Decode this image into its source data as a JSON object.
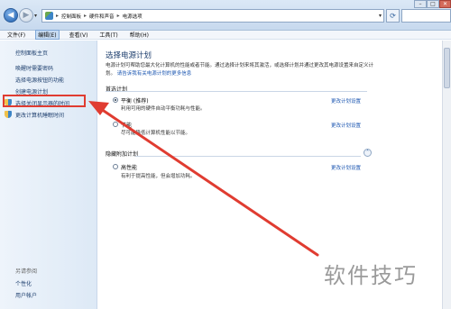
{
  "breadcrumb": {
    "items": [
      "控制面板",
      "硬件和声音",
      "电源选项"
    ]
  },
  "menu": {
    "items": [
      "文件(F)",
      "编辑(E)",
      "查看(V)",
      "工具(T)",
      "帮助(H)"
    ]
  },
  "sidebar": {
    "home": "控制面板主页",
    "items": [
      "唤醒时需要密码",
      "选择电源按钮的功能",
      "创建电源计划",
      "选择关闭显示器的时间",
      "更改计算机睡眠时间"
    ],
    "see_also_title": "另请参阅",
    "see_also": [
      "个性化",
      "用户帐户"
    ]
  },
  "main": {
    "title": "选择电源计划",
    "description": "电源计划可帮助您最大化计算机的性能或者节能。通过选择计划来将其激活，或选择计划并通过更改其电源设置来自定义计划。",
    "more_link": "请告诉我有关电源计划的更多信息",
    "preferred_label": "首选计划",
    "hidden_label": "隐藏附加计划",
    "plans": [
      {
        "name": "平衡 (推荐)",
        "desc": "利用可用的硬件自动平衡功耗与性能。",
        "link": "更改计划设置",
        "checked": true
      },
      {
        "name": "节能",
        "desc": "尽可能降低计算机性能以节能。",
        "link": "更改计划设置",
        "checked": false
      },
      {
        "name": "高性能",
        "desc": "有利于提高性能，但会增加功耗。",
        "link": "更改计划设置",
        "checked": false
      }
    ]
  },
  "watermark": "软件技巧",
  "colors": {
    "highlight": "#e03c31",
    "link": "#1a55b0",
    "title": "#1e3f6e"
  }
}
